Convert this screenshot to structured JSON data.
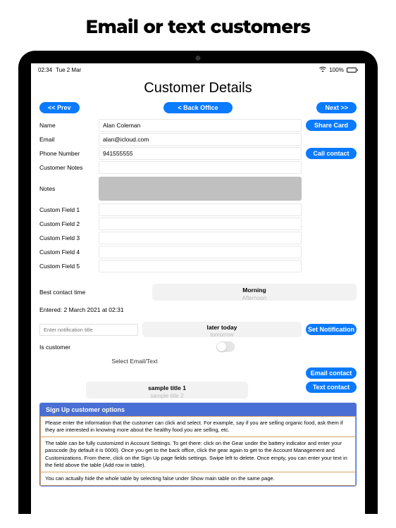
{
  "marketing_title": "Email or text customers",
  "status": {
    "time": "02:34",
    "date": "Tue 2 Mar",
    "battery": "100%"
  },
  "page_title": "Customer Details",
  "nav": {
    "prev": "<< Prev",
    "back": "< Back Office",
    "next": "Next >>"
  },
  "fields": {
    "name_label": "Name",
    "name_value": "Alan Coleman",
    "email_label": "Email",
    "email_value": "alan@icloud.com",
    "phone_label": "Phone Number",
    "phone_value": "941555555",
    "customer_notes_label": "Customer Notes",
    "notes_label": "Notes",
    "custom1_label": "Custom Field 1",
    "custom2_label": "Custom Field 2",
    "custom3_label": "Custom Field 3",
    "custom4_label": "Custom Field 4",
    "custom5_label": "Custom Field 5"
  },
  "buttons": {
    "share_card": "Share Card",
    "call_contact": "Call contact",
    "set_notification": "Set Notification",
    "email_contact": "Email contact",
    "text_contact": "Text contact"
  },
  "contact_time": {
    "label": "Best contact time",
    "selected": "Morning",
    "next": "Afternoon"
  },
  "entered": "Entered: 2 March 2021 at 02:31",
  "notification": {
    "placeholder": "Enter notification title",
    "selected": "later today",
    "next": "tomorrow"
  },
  "is_customer_label": "Is customer",
  "select_email_text": "Select Email/Text",
  "sample": {
    "selected": "sample title 1",
    "next": "sample title 2"
  },
  "options": {
    "header": "Sign Up customer options",
    "p1": "Please enter the information that the customer can click and select. For example, say if you are selling organic food, ask them if they are interested in knowing more about the healthy food you are selling, etc.",
    "p2": "The table can be fully customized in Account Settings. To get there: click on the Gear under the battery indicator and enter your passcode (by default it is 0000). Once you get to the back office, click the gear again to get to the Account Management and Customizations. From there, click on the Sign Up page fields settings. Swipe left to delete. Once empty, you can enter your text in the field above the table (Add row in table).",
    "p3": "You can actually hide the whole table by selecting false under Show main table on the same page."
  }
}
